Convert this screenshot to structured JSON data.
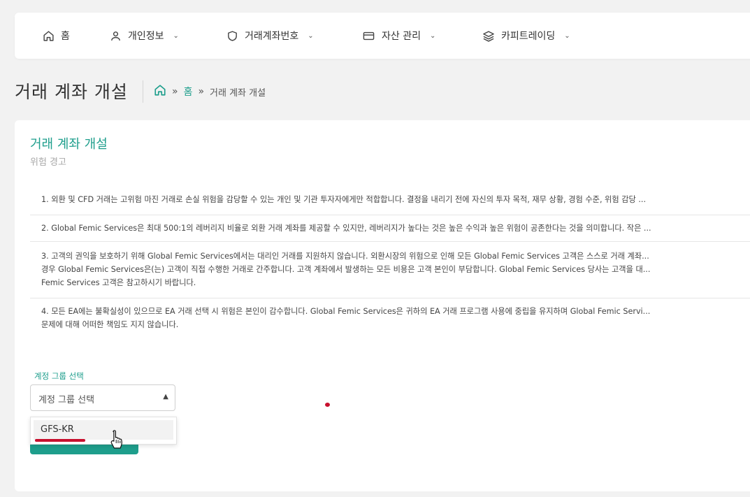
{
  "nav": {
    "items": [
      {
        "label": "홈",
        "icon": "home-icon",
        "has_dropdown": false
      },
      {
        "label": "개인정보",
        "icon": "user-icon",
        "has_dropdown": true
      },
      {
        "label": "거래계좌번호",
        "icon": "shield-icon",
        "has_dropdown": true
      },
      {
        "label": "자산 관리",
        "icon": "credit-card-icon",
        "has_dropdown": true
      },
      {
        "label": "카피트레이딩",
        "icon": "layers-icon",
        "has_dropdown": true
      }
    ]
  },
  "page": {
    "title": "거래 계좌 개설"
  },
  "breadcrumb": {
    "home_icon": "home-icon",
    "separator": "»",
    "home_label": "홈",
    "current": "거래 계좌 개설"
  },
  "card": {
    "title": "거래 계좌 개설",
    "subtitle": "위험 경고"
  },
  "notices": [
    [
      "1. 외환 및 CFD 거래는 고위험 마진 거래로 손실 위험을 감당할 수 있는 개인 및 기관 투자자에게만 적합합니다. 결정을 내리기 전에 자신의 투자 목적, 재무 상황, 경험 수준, 위험 감당 ..."
    ],
    [
      "2. Global Femic Services은 최대 500:1의 레버리지 비율로 외환 거래 계좌를 제공할 수 있지만, 레버리지가 높다는 것은 높은 수익과 높은 위험이 공존한다는 것을 의미합니다. 작은 ..."
    ],
    [
      "3. 고객의 권익을 보호하기 위해 Global Femic Services에서는 대리인 거래를 지원하지 않습니다. 외환시장의 위험으로 인해 모든 Global Femic Services 고객은 스스로 거래 계좌...",
      "경우 Global Femic Services은(는) 고객이 직접 수행한 거래로 간주합니다. 고객 계좌에서 발생하는 모든 비용은 고객 본인이 부담합니다. Global Femic Services 당사는 고객을 대...",
      "Femic Services 고객은 참고하시기 바랍니다."
    ],
    [
      "4. 모든 EA에는 불확실성이 있으므로 EA 거래 선택 시 위험은 본인이 감수합니다. Global Femic Services은 귀하의 EA 거래 프로그램 사용에 중립을 유지하며 Global Femic Servi...",
      "문제에 대해 어떠한 책임도 지지 않습니다."
    ]
  ],
  "form": {
    "group_label": "계정 그룹 선택",
    "select_placeholder": "계정 그룹 선택",
    "options": [
      "GFS-KR"
    ]
  },
  "colors": {
    "accent": "#1e9e8c",
    "annotation_red": "#c8102e"
  }
}
